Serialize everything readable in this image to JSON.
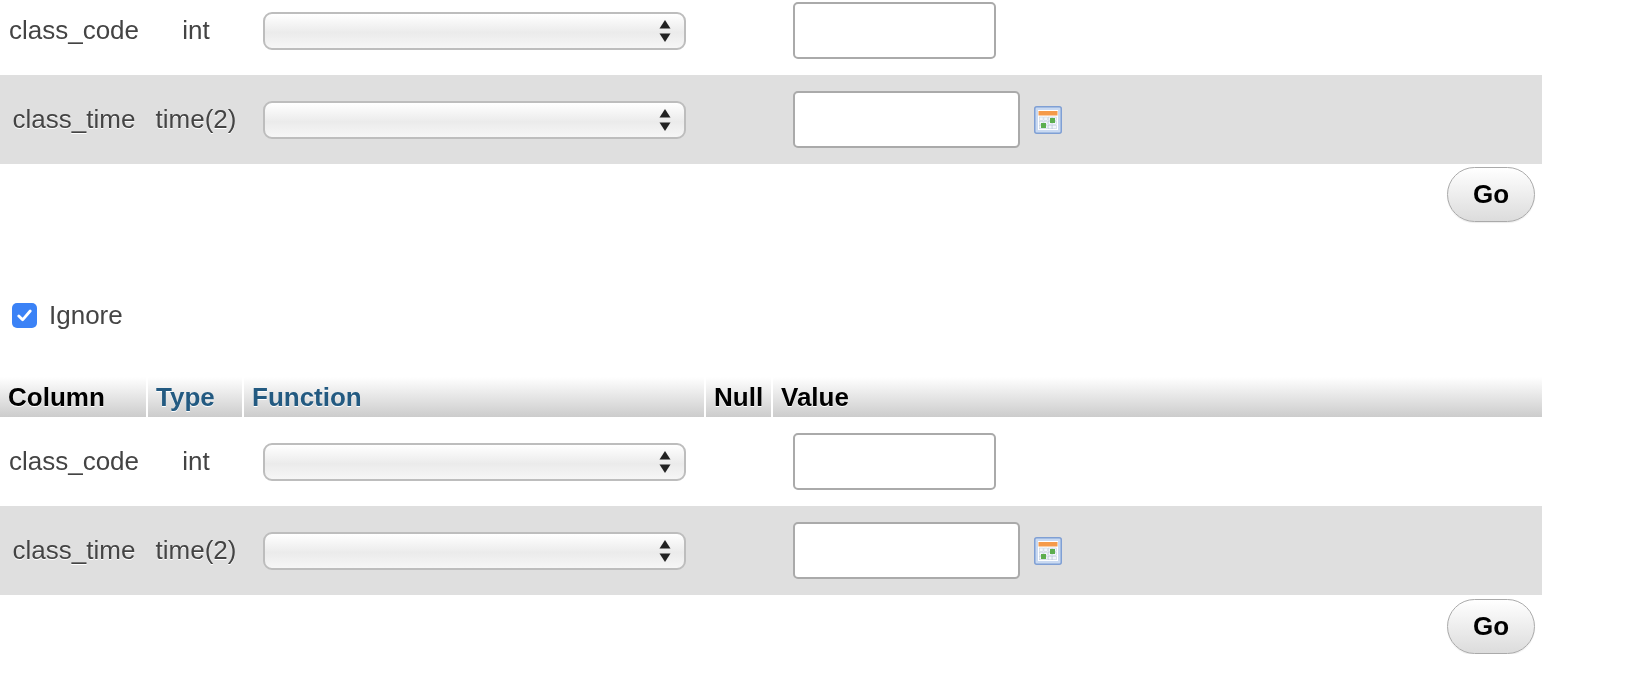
{
  "forms": [
    {
      "rows": [
        {
          "column": "class_code",
          "type": "int",
          "kind": "number"
        },
        {
          "column": "class_time",
          "type": "time(2)",
          "kind": "time"
        }
      ],
      "submit": "Go"
    },
    {
      "ignore": {
        "label": "Ignore",
        "checked": true
      },
      "columns": [
        {
          "label": "Column",
          "link": false
        },
        {
          "label": "Type",
          "link": true
        },
        {
          "label": "Function",
          "link": true
        },
        {
          "label": "Null",
          "link": false
        },
        {
          "label": "Value",
          "link": false
        }
      ],
      "rows": [
        {
          "column": "class_code",
          "type": "int",
          "kind": "number"
        },
        {
          "column": "class_time",
          "type": "time(2)",
          "kind": "time"
        }
      ],
      "submit": "Go"
    }
  ]
}
